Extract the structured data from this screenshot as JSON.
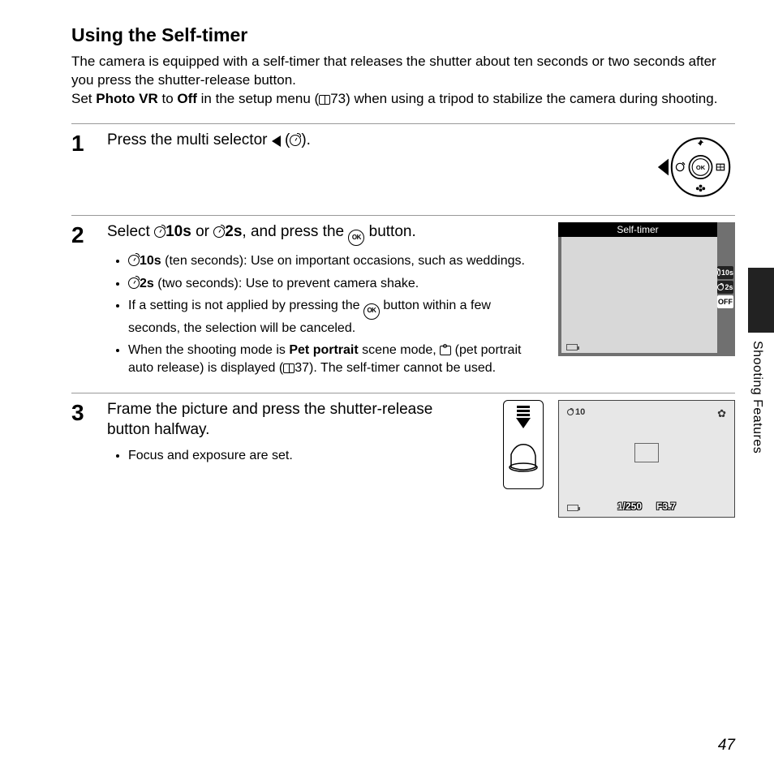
{
  "page": {
    "number": "47",
    "chapter": "Shooting Features"
  },
  "title": "Using the Self-timer",
  "intro": {
    "l1": "The camera is equipped with a self-timer that releases the shutter about ten seconds or two seconds after you press the shutter-release button.",
    "l2a": "Set ",
    "l2b": "Photo VR",
    "l2c": " to ",
    "l2d": "Off",
    "l2e": " in the setup menu (",
    "l2f": "73) when using a tripod to stabilize the camera during shooting."
  },
  "steps": [
    {
      "num": "1",
      "head_a": "Press the multi selector ",
      "head_b": " (",
      "head_c": ")."
    },
    {
      "num": "2",
      "head_a": "Select ",
      "head_b": "10s",
      "head_c": " or ",
      "head_d": "2s",
      "head_e": ", and press the ",
      "head_f": " button.",
      "bullets": [
        {
          "b": "10s",
          "t": " (ten seconds): Use on important occasions, such as weddings."
        },
        {
          "b": "2s",
          "t": " (two seconds): Use to prevent camera shake."
        },
        {
          "plain_a": "If a setting is not applied by pressing the ",
          "plain_b": " button within a few seconds, the selection will be canceled."
        },
        {
          "p1": "When the shooting mode is ",
          "pb": "Pet portrait",
          "p2": " scene mode, ",
          "p3": " (pet portrait auto release) is displayed (",
          "p4": "37). The self-timer cannot be used."
        }
      ]
    },
    {
      "num": "3",
      "head": "Frame the picture and press the shutter-release button halfway.",
      "bullet": "Focus and exposure are set."
    }
  ],
  "lcd2": {
    "title": "Self-timer",
    "options": [
      "10s",
      "2s",
      "OFF"
    ]
  },
  "lcd3": {
    "timer": "10",
    "shutter": "1/250",
    "aperture": "F3.7"
  }
}
